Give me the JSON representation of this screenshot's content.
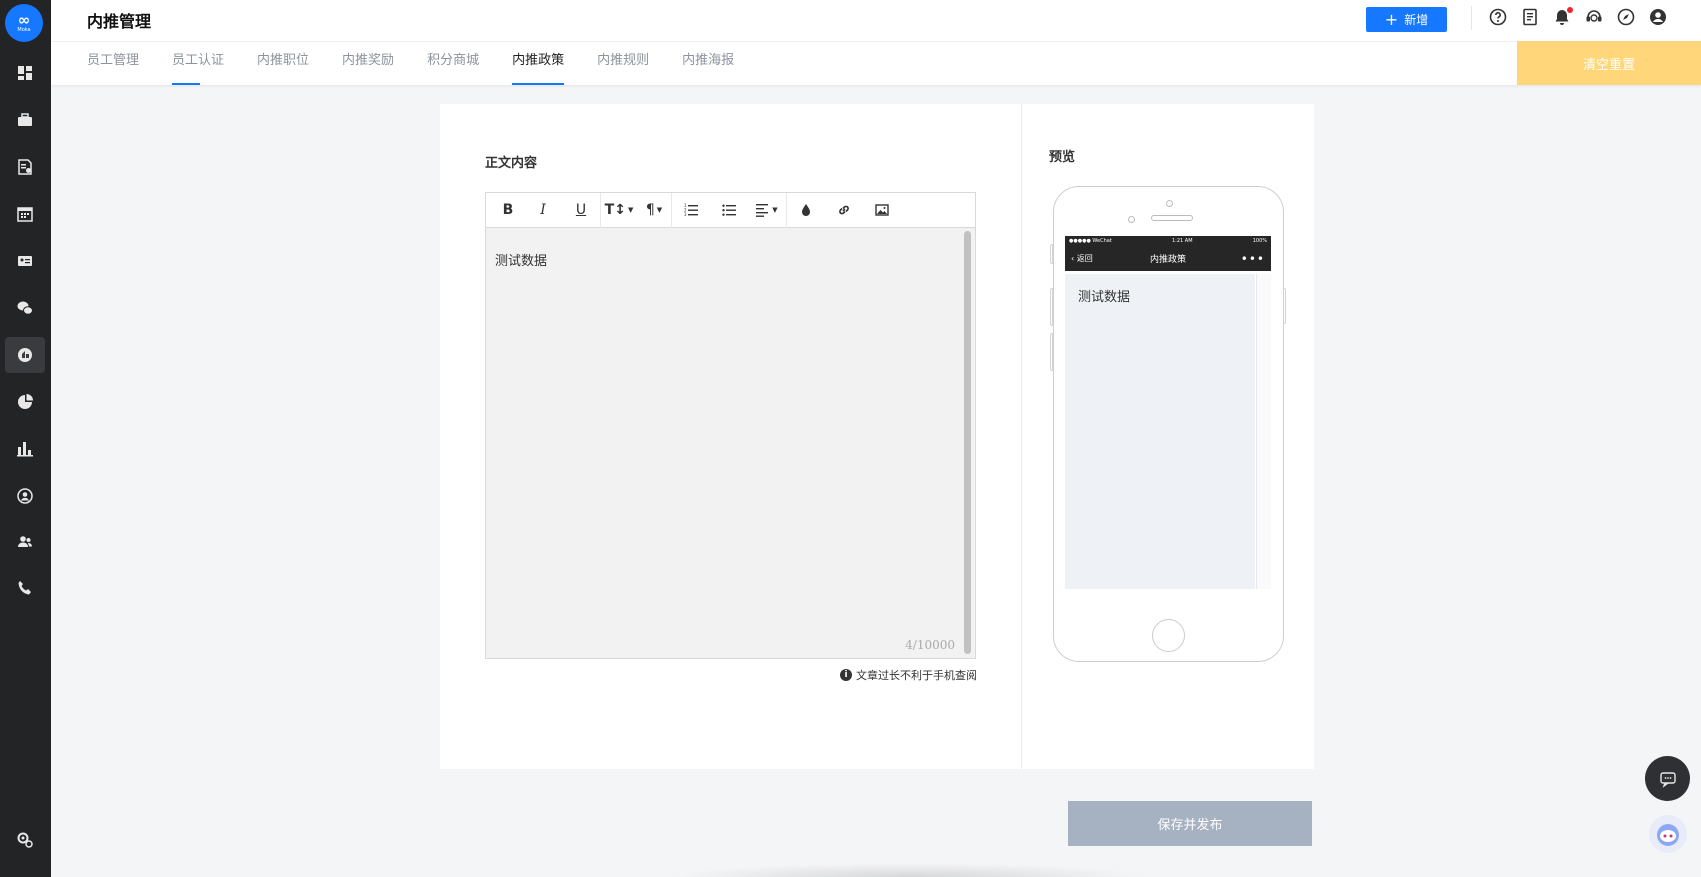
{
  "sidebar": {
    "logo_text": "Moka",
    "items": [
      "dashboard-icon",
      "briefcase-icon",
      "resume-icon",
      "calendar-icon",
      "id-card-icon",
      "wechat-icon",
      "referral-icon",
      "pie-chart-icon",
      "bar-chart-icon",
      "user-circle-icon",
      "team-icon",
      "phone-icon",
      "settings-icon"
    ],
    "active": "referral-icon"
  },
  "header": {
    "title": "内推管理",
    "new_button": "新增",
    "icons": [
      "help-icon",
      "document-icon",
      "bell-icon",
      "support-icon",
      "compass-icon",
      "user-icon"
    ],
    "tabs": [
      {
        "label": "员工管理"
      },
      {
        "label": "员工认证"
      },
      {
        "label": "内推职位"
      },
      {
        "label": "内推奖励"
      },
      {
        "label": "积分商城"
      },
      {
        "label": "内推政策"
      },
      {
        "label": "内推规则"
      },
      {
        "label": "内推海报"
      }
    ],
    "current_tab": "内推政策",
    "clear_button": "清空重置"
  },
  "editor": {
    "section_title": "正文内容",
    "content": "测试数据",
    "counter": "4/10000",
    "hint": "文章过长不利于手机查阅"
  },
  "preview": {
    "section_title": "预览",
    "status_left": "●●●●● WeChat",
    "status_time": "1:21 AM",
    "status_right": "100%",
    "back_label": "返回",
    "nav_title": "内推政策",
    "content": "测试数据"
  },
  "footer": {
    "save_button": "保存并发布"
  },
  "colors": {
    "primary": "#1677ff",
    "sidebar_bg": "#232426",
    "clear_btn": "#ffd77a",
    "save_btn": "#a6b1c2"
  }
}
